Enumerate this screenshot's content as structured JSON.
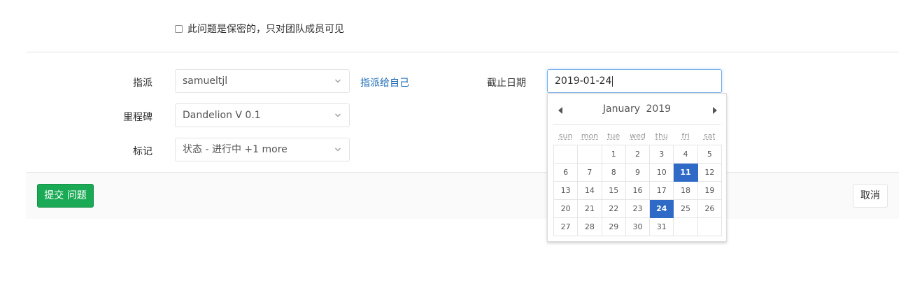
{
  "confidential": {
    "label": "此问题是保密的，只对团队成员可见",
    "checked": false
  },
  "fields": {
    "assignee": {
      "label": "指派",
      "value": "samueltjl",
      "assign_self": "指派给自己"
    },
    "milestone": {
      "label": "里程碑",
      "value": "Dandelion V 0.1"
    },
    "labels": {
      "label": "标记",
      "value": "状态 - 进行中 +1 more"
    },
    "due_date": {
      "label": "截止日期",
      "value": "2019-01-24"
    }
  },
  "datepicker": {
    "month": "January",
    "year": "2019",
    "weekdays": [
      "sun",
      "mon",
      "tue",
      "wed",
      "thu",
      "fri",
      "sat"
    ],
    "weeks": [
      [
        "",
        "",
        "1",
        "2",
        "3",
        "4",
        "5"
      ],
      [
        "6",
        "7",
        "8",
        "9",
        "10",
        "11",
        "12"
      ],
      [
        "13",
        "14",
        "15",
        "16",
        "17",
        "18",
        "19"
      ],
      [
        "20",
        "21",
        "22",
        "23",
        "24",
        "25",
        "26"
      ],
      [
        "27",
        "28",
        "29",
        "30",
        "31",
        "",
        ""
      ]
    ],
    "highlighted_days": [
      "11",
      "24"
    ],
    "selected_day": "24",
    "highlight_color": "#2f6bc6"
  },
  "footer": {
    "submit_label": "提交 问题",
    "cancel_label": "取消"
  },
  "colors": {
    "submit": "#1aaa55",
    "link": "#1b69b6",
    "focus_border": "#73afea"
  }
}
